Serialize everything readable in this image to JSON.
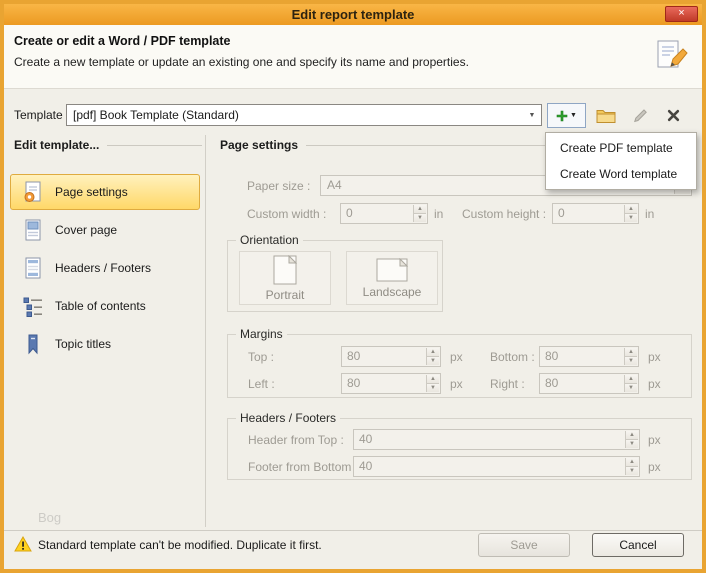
{
  "window": {
    "title": "Edit report template"
  },
  "icons": {
    "close": "×",
    "dropdown": "▼",
    "caret": "▼",
    "spin_up": "▲",
    "spin_down": "▼"
  },
  "header": {
    "title": "Create or edit a Word / PDF template",
    "subtitle": "Create a new template or update an existing one and specify its name and properties."
  },
  "template_bar": {
    "label": "Template :",
    "selected_template": "[pdf] Book Template (Standard)"
  },
  "create_menu": {
    "items": [
      {
        "label": "Create PDF template"
      },
      {
        "label": "Create Word template"
      }
    ]
  },
  "sidebar": {
    "title": "Edit template...",
    "items": [
      {
        "label": "Page settings",
        "selected": true
      },
      {
        "label": "Cover page",
        "selected": false
      },
      {
        "label": "Headers / Footers",
        "selected": false
      },
      {
        "label": "Table of contents",
        "selected": false
      },
      {
        "label": "Topic titles",
        "selected": false
      }
    ]
  },
  "page_settings": {
    "title": "Page settings",
    "paper_size": {
      "label": "Paper size :",
      "value": "A4"
    },
    "custom_width": {
      "label": "Custom width :",
      "value": "0",
      "unit": "in"
    },
    "custom_height": {
      "label": "Custom height :",
      "value": "0",
      "unit": "in"
    },
    "orientation": {
      "title": "Orientation",
      "portrait_label": "Portrait",
      "landscape_label": "Landscape"
    },
    "margins": {
      "title": "Margins",
      "top": {
        "label": "Top :",
        "value": "80",
        "unit": "px"
      },
      "bottom": {
        "label": "Bottom :",
        "value": "80",
        "unit": "px"
      },
      "left": {
        "label": "Left :",
        "value": "80",
        "unit": "px"
      },
      "right": {
        "label": "Right :",
        "value": "80",
        "unit": "px"
      }
    },
    "headers_footers": {
      "title": "Headers / Footers",
      "header_from_top": {
        "label": "Header from Top :",
        "value": "40",
        "unit": "px"
      },
      "footer_from_bottom": {
        "label": "Footer from Bottom :",
        "value": "40",
        "unit": "px"
      }
    }
  },
  "status_bar": {
    "warning": "Standard template can't be modified. Duplicate it first.",
    "save_label": "Save",
    "cancel_label": "Cancel"
  },
  "watermark": "Bog",
  "colors": {
    "accent_orange": "#E9A432",
    "titlebar_top": "#F9B646",
    "titlebar_bottom": "#EC9A22",
    "selected_item": "#FFD868",
    "close_red": "#C03A28",
    "plus_green": "#2EA12E",
    "warning_yellow": "#FFD21E",
    "disabled_text": "#9E9B93"
  }
}
